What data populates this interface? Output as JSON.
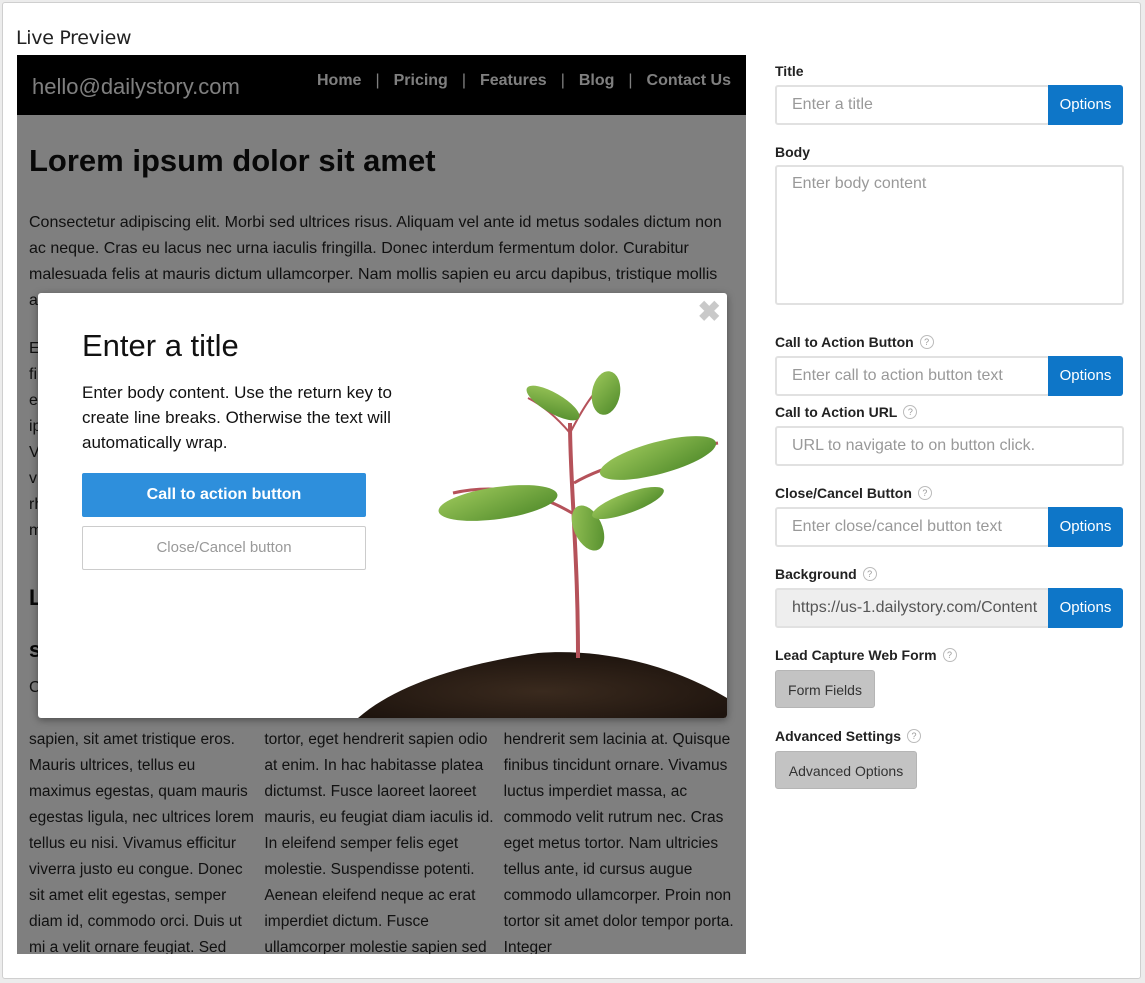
{
  "header": {
    "title": "Live Preview"
  },
  "preview": {
    "site_email": "hello@dailystory.com",
    "nav": [
      "Home",
      "Pricing",
      "Features",
      "Blog",
      "Contact Us"
    ],
    "h1": "Lorem ipsum dolor sit amet",
    "p1": "Consectetur adipiscing elit. Morbi sed ultrices risus. Aliquam vel ante id metus sodales dictum non ac neque. Cras eu lacus nec urna iaculis fringilla. Donec interdum fermentum dolor. Curabitur malesuada felis at mauris dictum ullamcorper. Nam mollis sapien eu arcu dapibus, tristique mollis a",
    "col1": "sapien, sit amet tristique eros. Mauris ultrices, tellus eu maximus egestas, quam mauris egestas ligula, nec ultrices lorem tellus eu nisi. Vivamus efficitur viverra justo eu congue. Donec sit amet elit egestas, semper diam id, commodo orci. Duis ut mi a velit ornare feugiat. Sed",
    "col2": "tortor, eget hendrerit sapien odio at enim. In hac habitasse platea dictumst. Fusce laoreet laoreet mauris, eu feugiat diam iaculis id. In eleifend semper felis eget molestie. Suspendisse potenti. Aenean eleifend neque ac erat imperdiet dictum. Fusce ullamcorper molestie sapien sed",
    "col3": "hendrerit sem lacinia at. Quisque finibus tincidunt ornare. Vivamus luctus imperdiet massa, ac commodo velit rutrum nec. Cras eget metus tortor. Nam ultricies tellus ante, id cursus augue commodo ullamcorper. Proin non tortor sit amet dolor tempor porta. Integer"
  },
  "modal": {
    "close_glyph": "✖",
    "title": "Enter a title",
    "body": "Enter body content. Use the return key to create line breaks. Otherwise the text will automatically wrap.",
    "cta": "Call to action button",
    "cancel": "Close/Cancel button"
  },
  "form": {
    "title_label": "Title",
    "title_placeholder": "Enter a title",
    "body_label": "Body",
    "body_placeholder": "Enter body content",
    "cta_label": "Call to Action Button",
    "cta_placeholder": "Enter call to action button text",
    "url_label": "Call to Action URL",
    "url_placeholder": "URL to navigate to on button click.",
    "close_label": "Close/Cancel Button",
    "close_placeholder": "Enter close/cancel button text",
    "bg_label": "Background",
    "bg_value": "https://us-1.dailystory.com/Content",
    "lead_label": "Lead Capture Web Form",
    "form_fields": "Form Fields",
    "adv_label": "Advanced Settings",
    "adv_button": "Advanced Options",
    "options": "Options",
    "help": "?"
  },
  "colors": {
    "accent": "#0e76c8",
    "cta": "#2e8fdc",
    "nav_bg": "#000000"
  }
}
